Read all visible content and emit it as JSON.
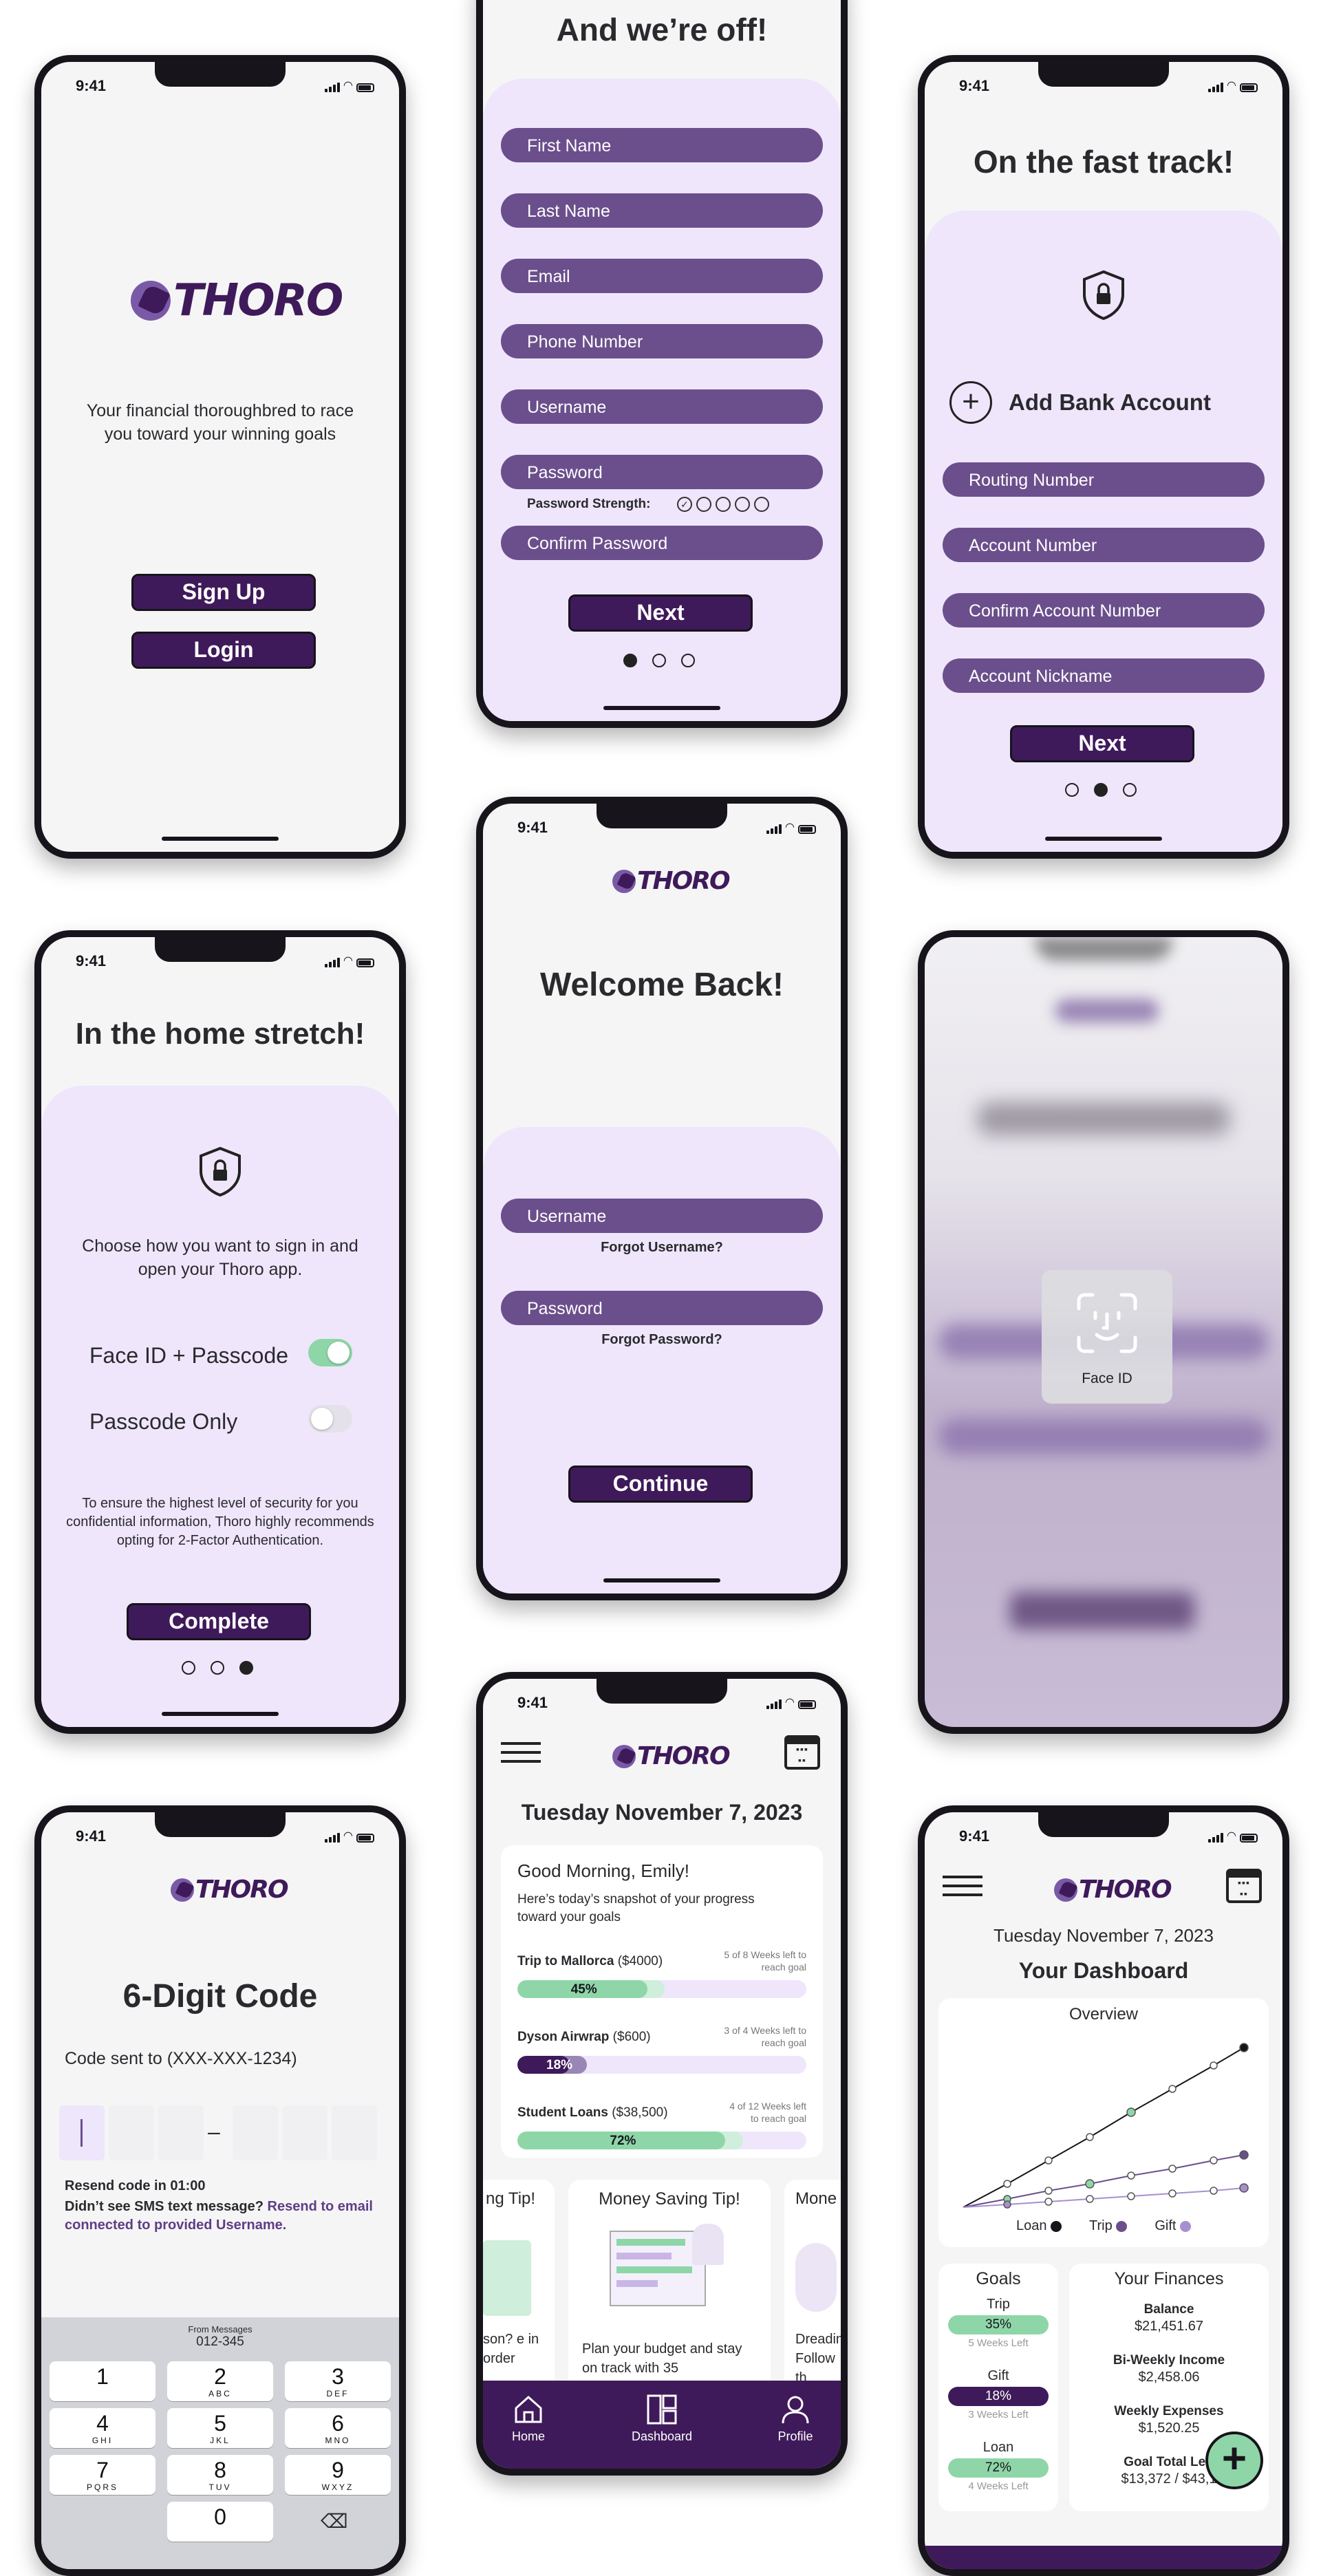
{
  "status_time": "9:41",
  "brand": {
    "wordmark": "THORO",
    "purple": "#3f1a5a",
    "pill_purple": "#6b4f8c",
    "lavender": "#efe6fc",
    "green": "#8ed6a8"
  },
  "welcome_screen": {
    "tagline": "Your financial thoroughbred to race you toward your winning goals",
    "signup_label": "Sign Up",
    "login_label": "Login"
  },
  "signup_screen": {
    "title": "And we’re off!",
    "fields": [
      "First Name",
      "Last Name",
      "Email",
      "Phone Number",
      "Username",
      "Password"
    ],
    "strength_label": "Password Strength:",
    "confirm_field": "Confirm Password",
    "next_label": "Next"
  },
  "bank_screen": {
    "title": "On the fast track!",
    "add_bank_label": "Add Bank Account",
    "fields": [
      "Routing Number",
      "Account Number",
      "Confirm Account Number",
      "Account Nickname"
    ],
    "next_label": "Next"
  },
  "security_screen": {
    "title": "In the home stretch!",
    "prompt": "Choose how you want to sign in and open your Thoro app.",
    "option_faceid": "Face ID + Passcode",
    "option_passcode": "Passcode Only",
    "faceid_on": true,
    "passcode_on": false,
    "note": "To ensure the highest level of security for you confidential information, Thoro highly recommends opting for 2-Factor Authentication.",
    "complete_label": "Complete"
  },
  "login_screen": {
    "title": "Welcome Back!",
    "username_placeholder": "Username",
    "forgot_username": "Forgot Username?",
    "password_placeholder": "Password",
    "forgot_password": "Forgot Password?",
    "continue_label": "Continue"
  },
  "faceid_screen": {
    "label": "Face ID"
  },
  "code_screen": {
    "title": "6-Digit Code",
    "sent_to": "Code sent to (XXX-XXX-1234)",
    "resend_in": "Resend code in 01:00",
    "didnt_see": "Didn’t see SMS text message?",
    "resend_link": "Resend to email connected to provided Username.",
    "suggest_from": "From Messages",
    "suggest_code": "012-345",
    "keys": [
      {
        "n": "1",
        "l": ""
      },
      {
        "n": "2",
        "l": "ABC"
      },
      {
        "n": "3",
        "l": "DEF"
      },
      {
        "n": "4",
        "l": "GHI"
      },
      {
        "n": "5",
        "l": "JKL"
      },
      {
        "n": "6",
        "l": "MNO"
      },
      {
        "n": "7",
        "l": "PQRS"
      },
      {
        "n": "8",
        "l": "TUV"
      },
      {
        "n": "9",
        "l": "WXYZ"
      },
      {
        "n": "0",
        "l": ""
      }
    ]
  },
  "home_screen": {
    "date": "Tuesday November 7, 2023",
    "greeting": "Good Morning, Emily!",
    "snapshot": "Here’s today’s snapshot of your progress toward your goals",
    "goals": [
      {
        "name": "Trip to Mallorca",
        "amount": "($4000)",
        "weeks": "5 of 8 Weeks left to reach goal",
        "percent": 45,
        "label": "45%"
      },
      {
        "name": "Dyson Airwrap",
        "amount": "($600)",
        "weeks": "3 of 4 Weeks left to reach goal",
        "percent": 18,
        "label": "18%"
      },
      {
        "name": "Student Loans",
        "amount": "($38,500)",
        "weeks": "4 of 12 Weeks left to reach goal",
        "percent": 72,
        "label": "72%"
      }
    ],
    "tip_left_title": "ng Tip!",
    "tip_left_body": "son? e in order",
    "tip_center_title": "Money Saving Tip!",
    "tip_center_body": "Plan your budget and stay on track with 35",
    "tip_right_title": "Mone",
    "tip_right_body": "Dreading Follow th",
    "nav": [
      {
        "label": "Home"
      },
      {
        "label": "Dashboard"
      },
      {
        "label": "Profile"
      }
    ]
  },
  "dashboard_screen": {
    "date": "Tuesday November 7, 2023",
    "title": "Your Dashboard",
    "overview_title": "Overview",
    "legend": [
      {
        "name": "Loan",
        "color": "#17141b"
      },
      {
        "name": "Trip",
        "color": "#6b4f8c"
      },
      {
        "name": "Gift",
        "color": "#a78fd0"
      }
    ],
    "goals_title": "Goals",
    "goals": [
      {
        "name": "Trip",
        "label": "35%",
        "weeks": "5 Weeks Left",
        "style": "green"
      },
      {
        "name": "Gift",
        "label": "18%",
        "weeks": "3 Weeks Left",
        "style": "purple"
      },
      {
        "name": "Loan",
        "label": "72%",
        "weeks": "4 Weeks Left",
        "style": "green"
      }
    ],
    "finances_title": "Your Finances",
    "finances": [
      {
        "label": "Balance",
        "value": "$21,451.67"
      },
      {
        "label": "Bi-Weekly Income",
        "value": "$2,458.06"
      },
      {
        "label": "Weekly Expenses",
        "value": "$1,520.25"
      },
      {
        "label": "Goal Total Left",
        "value": "$13,372 / $43,1"
      }
    ]
  }
}
